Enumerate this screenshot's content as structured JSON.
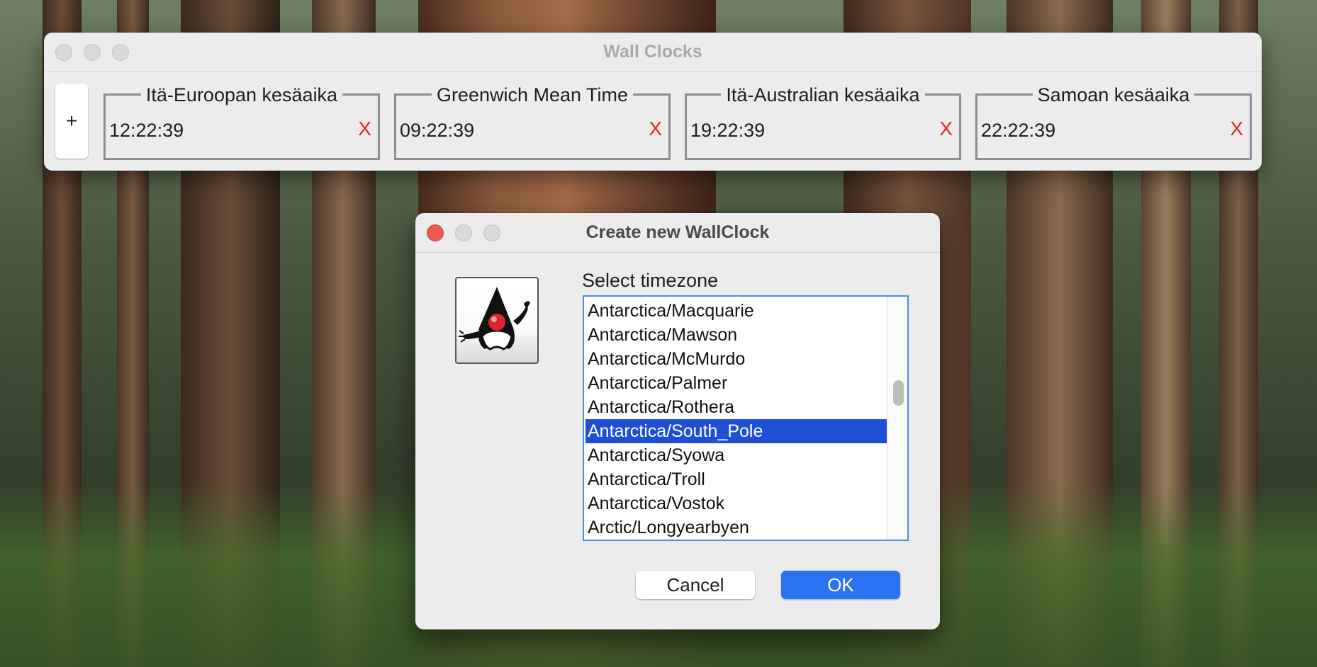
{
  "main_window": {
    "title": "Wall Clocks",
    "add_button_label": "+",
    "clocks": [
      {
        "timezone": "Itä-Euroopan kesäaika",
        "time": "12:22:39",
        "remove_label": "X"
      },
      {
        "timezone": "Greenwich Mean Time",
        "time": "09:22:39",
        "remove_label": "X"
      },
      {
        "timezone": "Itä-Australian kesäaika",
        "time": "19:22:39",
        "remove_label": "X"
      },
      {
        "timezone": "Samoan kesäaika",
        "time": "22:22:39",
        "remove_label": "X"
      }
    ]
  },
  "dialog": {
    "title": "Create new WallClock",
    "label": "Select timezone",
    "icon": "java-duke-icon",
    "timezones": [
      "Antarctica/Macquarie",
      "Antarctica/Mawson",
      "Antarctica/McMurdo",
      "Antarctica/Palmer",
      "Antarctica/Rothera",
      "Antarctica/South_Pole",
      "Antarctica/Syowa",
      "Antarctica/Troll",
      "Antarctica/Vostok",
      "Arctic/Longyearbyen"
    ],
    "selected_timezone": "Antarctica/South_Pole",
    "cancel_label": "Cancel",
    "ok_label": "OK"
  },
  "colors": {
    "accent": "#2a72f0",
    "selection": "#1f4fd5",
    "remove": "#e4261d",
    "close": "#ee5b55"
  }
}
